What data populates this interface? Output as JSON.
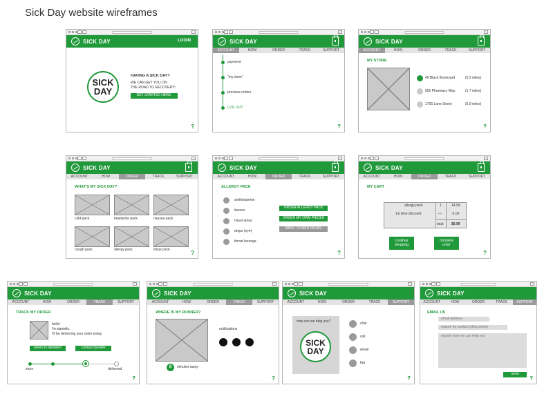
{
  "page_title": "Sick Day website wireframes",
  "brand": "SICK DAY",
  "help_glyph": "?",
  "nav": {
    "account": "ACCOUNT",
    "how": "HOW",
    "order": "ORDER",
    "track": "TRACK",
    "support": "SUPPORT"
  },
  "colors": {
    "brand_green": "#20993a",
    "tab_active": "#9a9a9a",
    "placeholder": "#c9c9c9"
  },
  "home": {
    "login": "LOGIN",
    "logo_line1": "SICK",
    "logo_line2": "DAY",
    "headline": "HAVING A SICK DAY?",
    "sub1": "WE CAN GET YOU ON",
    "sub2": "THE ROAD TO RECOVERY!",
    "cta": "GET STARTED HERE."
  },
  "account": {
    "items": [
      "payment",
      "\"my store\"",
      "previous orders",
      "LOG OUT"
    ]
  },
  "store": {
    "heading": "MY STORE",
    "locations": [
      {
        "name": "49 Black Boulevard",
        "distance": "(0.2 miles)"
      },
      {
        "name": "555 Pharmacy Way",
        "distance": "(1.7 miles)"
      },
      {
        "name": "1705 Lane Street",
        "distance": "(5.9 miles)"
      }
    ]
  },
  "order": {
    "heading": "WHAT'S MY SICK DAY?",
    "packs": [
      "cold pack",
      "headache pack",
      "nausea pack",
      "cough pack",
      "allergy pack",
      "sinus pack"
    ]
  },
  "allergy": {
    "heading": "ALLERGY PACK",
    "items": [
      "antihistamine",
      "tissues",
      "nasal spray",
      "drops (eye)",
      "throat lozenge"
    ],
    "btn_order_pack": "ORDER ALLERGY PACK",
    "btn_own_pieces": "ORDER MY OWN PIECES",
    "btn_back": "BACK TO MED PACKS"
  },
  "cart": {
    "heading": "MY CART",
    "rows": [
      {
        "label": "allergy pack",
        "qty": "1",
        "price": "14.99"
      },
      {
        "label": "1st time discount",
        "qty": "—",
        "price": "-5.00"
      }
    ],
    "total_label": "total",
    "total_value": "$9.99",
    "continue": [
      "continue",
      "shopping"
    ],
    "complete": [
      "complete",
      "order"
    ]
  },
  "track": {
    "heading": "TRACK MY ORDER",
    "msg": [
      "hello!",
      "I'm danielle.",
      "I'll be delivering your order today."
    ],
    "btn_who": "where is danielle?",
    "btn_contact": "contact danielle",
    "start": "store",
    "end": "delivered"
  },
  "runner": {
    "heading": "WHERE IS MY RUNNER?",
    "notifications": "notifications",
    "minutes": "8",
    "minutes_label": "minutes away"
  },
  "support": {
    "prompt": "how can we help you?",
    "logo_line1": "SICK",
    "logo_line2": "DAY",
    "options": [
      "chat",
      "call",
      "email",
      "faq"
    ]
  },
  "email": {
    "heading": "EMAIL US",
    "field1": "email address",
    "field2": "reason for contact (drop down)",
    "field3": "explain how we can help you",
    "send": "send"
  }
}
